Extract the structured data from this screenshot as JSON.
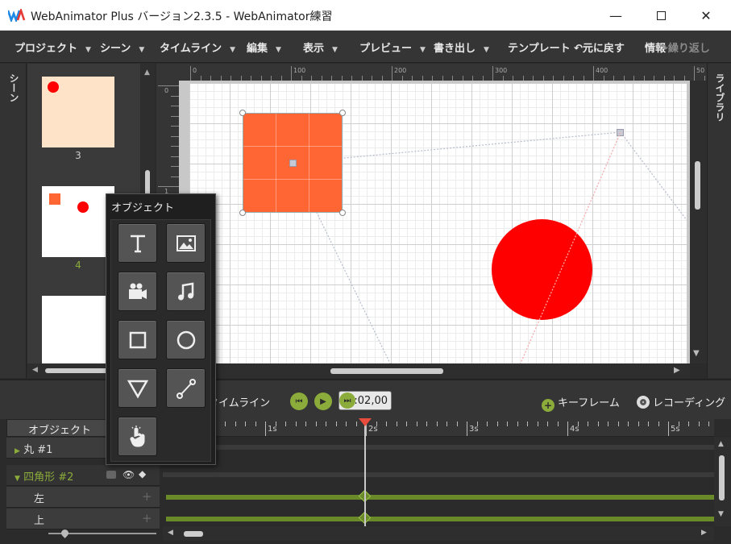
{
  "window": {
    "title": "WebAnimator Plus バージョン2.3.5 - WebAnimator練習"
  },
  "menu": [
    {
      "label": "プロジェクト"
    },
    {
      "label": "シーン"
    },
    {
      "label": "タイムライン"
    },
    {
      "label": "編集"
    },
    {
      "label": "表示"
    },
    {
      "label": "プレビュー"
    },
    {
      "label": "書き出し"
    },
    {
      "label": "テンプレート"
    }
  ],
  "toolbar": {
    "undo": "元に戻す",
    "info": "情報",
    "redo": "繰り返し"
  },
  "panels": {
    "scenes": "シーン",
    "library": "ライブラリ",
    "objects": "オブジェクト"
  },
  "scenes": [
    {
      "number": "3"
    },
    {
      "number": "4"
    }
  ],
  "ruler": {
    "h": [
      "0",
      "100",
      "200",
      "300",
      "400",
      "50"
    ],
    "v": [
      "0",
      "1"
    ]
  },
  "timeline": {
    "label": "タイムライン",
    "time": "00:02,00",
    "keyframe": "キーフレーム",
    "recording": "レコーディング",
    "objects_header": "オブジェクト",
    "ticks": [
      "1s",
      "2s",
      "3s",
      "4s",
      "5s"
    ],
    "rows": [
      {
        "label": "丸 #1"
      },
      {
        "label": "四角形 #2"
      },
      {
        "label": "左"
      },
      {
        "label": "上"
      }
    ]
  },
  "colors": {
    "square": "#ff6633",
    "circle": "#ff0000",
    "accent": "#8bab3a",
    "thumb3_bg": "#ffe3c8"
  }
}
